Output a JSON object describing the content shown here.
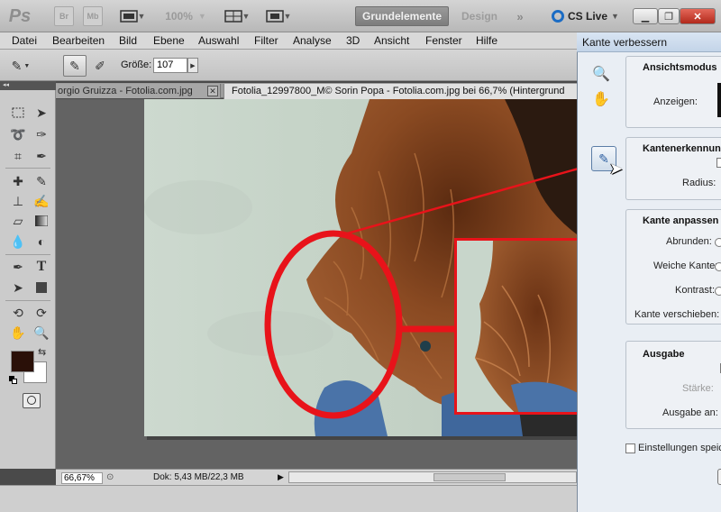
{
  "app": {
    "logo": "Ps",
    "bridge": "Br",
    "minibridge": "Mb",
    "zoom": "100%",
    "workspaces": {
      "active": "Grundelemente",
      "other": "Design",
      "more": "»"
    },
    "cs_live": "CS Live"
  },
  "menu": [
    "Datei",
    "Bearbeiten",
    "Bild",
    "Ebene",
    "Auswahl",
    "Filter",
    "Analyse",
    "3D",
    "Ansicht",
    "Fenster",
    "Hilfe"
  ],
  "options": {
    "size_label": "Größe:",
    "size_value": "107"
  },
  "tabs": [
    {
      "label": "orgio Gruizza - Fotolia.com.jpg"
    },
    {
      "label": "Fotolia_12997800_M© Sorin Popa - Fotolia.com.jpg bei 66,7% (Hintergrund"
    }
  ],
  "status": {
    "zoom": "66,67%",
    "doc": "Dok: 5,43 MB/22,3 MB"
  },
  "dialog": {
    "title": "Kante verbessern",
    "ansichtsmodus": {
      "title": "Ansichtsmodus",
      "anzeigen": "Anzeigen:"
    },
    "kantenerkennung": {
      "title": "Kantenerkennung",
      "radius": "Radius:"
    },
    "kante_anpassen": {
      "title": "Kante anpassen",
      "abrunden": "Abrunden:",
      "weiche_kante": "Weiche Kante:",
      "kontrast": "Kontrast:",
      "kante_verschieben": "Kante verschieben:"
    },
    "ausgabe": {
      "title": "Ausgabe",
      "staerke": "Stärke:",
      "ausgabe_an": "Ausgabe an:"
    },
    "einstellungen": "Einstellungen speichern"
  },
  "colors": {
    "annotation_red": "#e8131a",
    "foreground": "#2a1008",
    "background": "#ffffff",
    "hair": "#7a3e1c",
    "shirt": "#4a73a8"
  }
}
